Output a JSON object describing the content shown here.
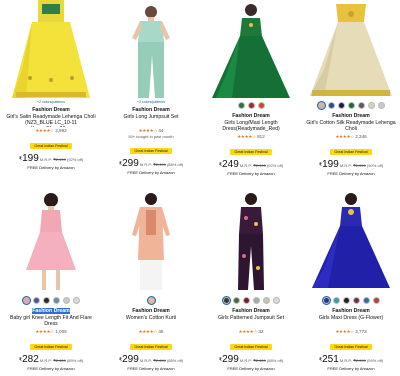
{
  "colors": {
    "link": "#2162a1",
    "star": "#de7921",
    "badge_bg": "#ffd814",
    "highlight": "#2b6fd6"
  },
  "products": [
    {
      "see_more": "+2 colors/patterns",
      "brand": "Fashion Dream",
      "title": "Girl's Satin Readymade Lehenga Choli (NZ3_BLUE LC_10-11 Years_Blue_10-...",
      "stars": "★★★★☆",
      "review_count": "2,992",
      "bought": "",
      "badge": "Great Indian Festival",
      "rupee": "₹",
      "price": "199",
      "mrp_label": "M.R.P:",
      "mrp": "₹2,499",
      "discount": "(92% off)",
      "delivery": "FREE Delivery by Amazon"
    },
    {
      "see_more": "+2 colors/patterns",
      "brand": "Fashion Dream",
      "title": "Girls Long Jumpsuit Set",
      "stars": "★★★★☆",
      "review_count": "44",
      "bought": "50+ bought in past month",
      "badge": "Great Indian Festival",
      "rupee": "₹",
      "price": "299",
      "mrp_label": "M.R.P:",
      "mrp": "₹2,499",
      "discount": "(88% off)",
      "delivery": "FREE Delivery by Amazon"
    },
    {
      "see_more": "",
      "brand": "Fashion Dream",
      "title": "Girls Long/Maxi Length Dress(Readymade_Red)",
      "stars": "★★★★☆",
      "review_count": "812",
      "bought": "",
      "badge": "Great Indian Festival",
      "rupee": "₹",
      "price": "249",
      "mrp_label": "M.R.P:",
      "mrp": "₹2,999",
      "discount": "(92% off)",
      "delivery": "FREE Delivery by Amazon"
    },
    {
      "see_more": "",
      "brand": "Fashion Dream",
      "title": "Girl's Cotton Silk Readymade Lehenga Choli",
      "stars": "★★★★☆",
      "review_count": "2,346",
      "bought": "",
      "badge": "Great Indian Festival",
      "rupee": "₹",
      "price": "199",
      "mrp_label": "M.R.P:",
      "mrp": "₹1,999",
      "discount": "(90% off)",
      "delivery": "FREE Delivery by Amazon"
    },
    {
      "see_more": "",
      "brand": "Fashion Dream",
      "title": "Baby girl Knee Length Fit And Flare Dress",
      "stars": "★★★★☆",
      "review_count": "1,009",
      "bought": "",
      "badge": "Great Indian Festival",
      "rupee": "₹",
      "price": "282",
      "mrp_label": "M.R.P:",
      "mrp": "₹2,499",
      "discount": "(89% off)",
      "delivery": "FREE Delivery by Amazon"
    },
    {
      "see_more": "",
      "brand": "Fashion Dream",
      "title": "Women's Cotton Kurti",
      "stars": "★★★★☆",
      "review_count": "45",
      "bought": "",
      "badge": "Great Indian Festival",
      "rupee": "₹",
      "price": "299",
      "mrp_label": "M.R.P:",
      "mrp": "₹2,499",
      "discount": "(88% off)",
      "delivery": "FREE Delivery by Amazon"
    },
    {
      "see_more": "",
      "brand": "Fashion Dream",
      "title": "Girls Patterned Jumpsuit Set",
      "stars": "★★★★☆",
      "review_count": "32",
      "bought": "",
      "badge": "Great Indian Festival",
      "rupee": "₹",
      "price": "299",
      "mrp_label": "M.R.P:",
      "mrp": "₹2,499",
      "discount": "(88% off)",
      "delivery": "FREE Delivery by Amazon"
    },
    {
      "see_more": "",
      "brand": "Fashion Dream",
      "title": "Girls Maxi Dress (G-Flower)",
      "stars": "★★★★☆",
      "review_count": "2,773",
      "bought": "",
      "badge": "Great Indian Festival",
      "rupee": "₹",
      "price": "251",
      "mrp_label": "M.R.P:",
      "mrp": "₹2,999",
      "discount": "(94% off)",
      "delivery": "FREE Delivery by Amazon"
    }
  ],
  "swatches": {
    "p3": [
      "#cbb89a",
      "#2a4a9a",
      "#1b1b4a",
      "#1f6b3a",
      "#5a5a5a",
      "#d8d0b8",
      "#c8c8c8"
    ],
    "p4": [
      "#2a3a8a",
      "#3aa0a0",
      "#222222",
      "#7a2a4a",
      "#3a6a9a",
      "#bb3a3a"
    ],
    "p5": [
      "#f0a0a8",
      "#4a5a8a",
      "#2a2a2a",
      "#6a8aa0",
      "#c8c8c8",
      "#d8d8d8"
    ],
    "p6": [
      "#3a3a3a",
      "#4a6a3a",
      "#7a1a2a",
      "#9ab0a8",
      "#c9c1b0",
      "#d8d8d8"
    ]
  }
}
